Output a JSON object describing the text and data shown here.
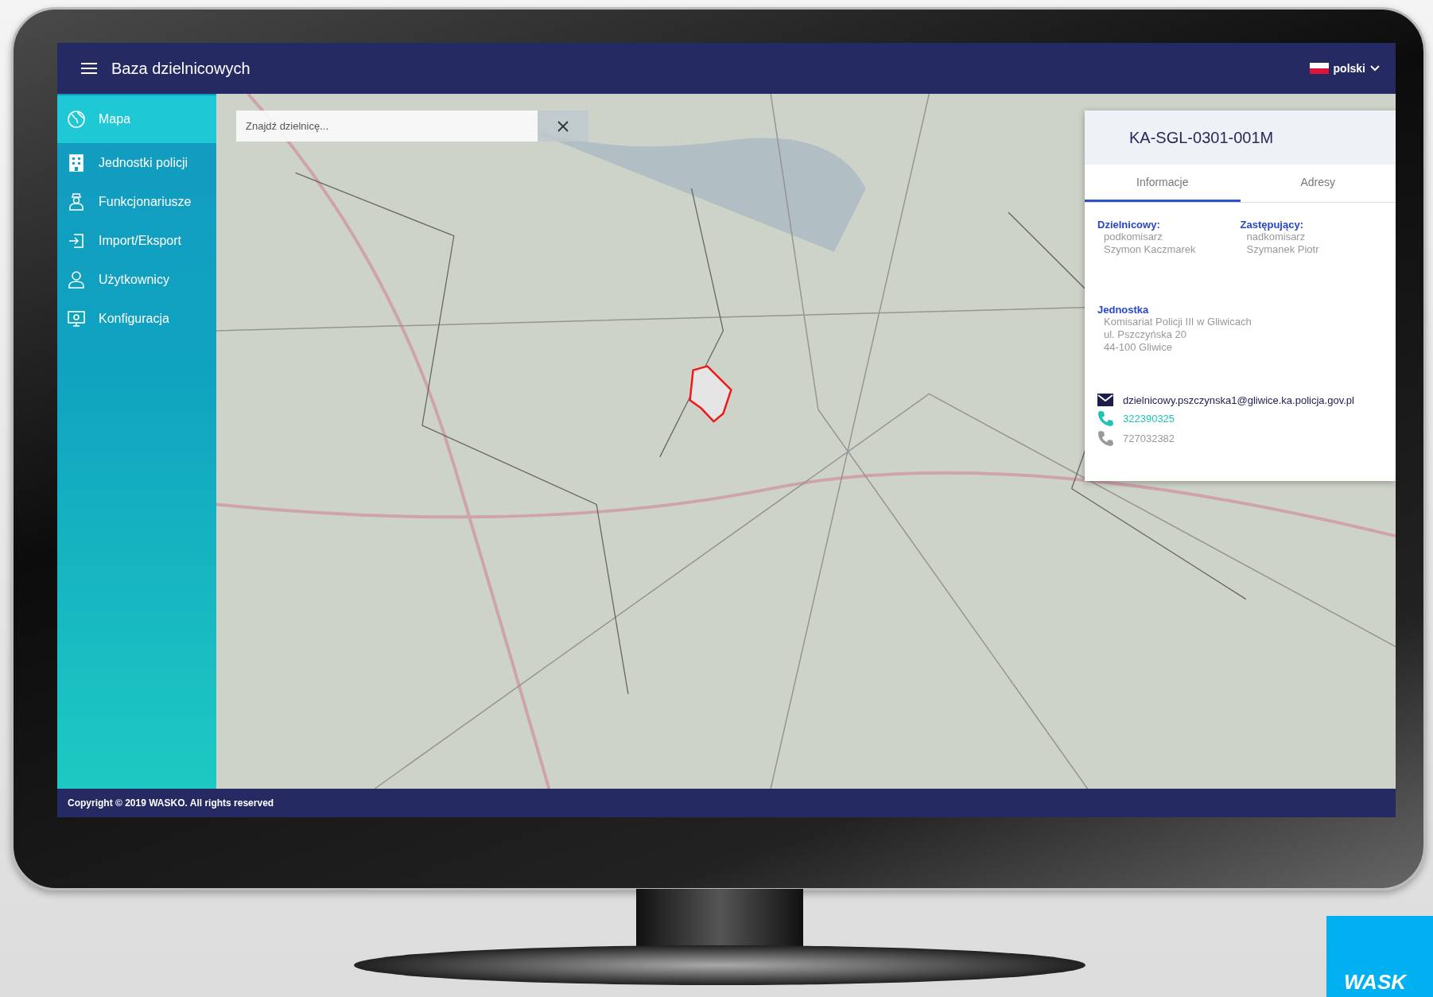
{
  "app": {
    "title": "Baza dzielnicowych",
    "language": {
      "label": "polski"
    }
  },
  "sidebar": {
    "items": [
      {
        "label": "Mapa",
        "selected": true
      },
      {
        "label": "Jednostki policji",
        "selected": false
      },
      {
        "label": "Funkcjonariusze",
        "selected": false
      },
      {
        "label": "Import/Eksport",
        "selected": false
      },
      {
        "label": "Użytkownicy",
        "selected": false
      },
      {
        "label": "Konfiguracja",
        "selected": false
      }
    ]
  },
  "search": {
    "placeholder": "Znajdź dzielnicę..."
  },
  "panel": {
    "title": "KA-SGL-0301-001M",
    "tabs": [
      {
        "label": "Informacje",
        "selected": true
      },
      {
        "label": "Adresy",
        "selected": false
      }
    ],
    "officers": [
      {
        "heading": "Dzielnicowy:",
        "rank": "podkomisarz",
        "name": "Szymon Kaczmarek"
      },
      {
        "heading": "Zastępujący:",
        "rank": "nadkomisarz",
        "name": "Szymanek Piotr"
      }
    ],
    "unit": {
      "heading": "Jednostka",
      "lines": [
        "Komisariat Policji III w Gliwicach",
        "ul. Pszczyńska 20",
        "44-100 Gliwice"
      ]
    },
    "contacts": [
      {
        "kind": "email",
        "value": "dzielnicowy.pszczynska1@gliwice.ka.policja.gov.pl",
        "primary": false
      },
      {
        "kind": "phone",
        "value": "322390325",
        "primary": true
      },
      {
        "kind": "phone",
        "value": "727032382",
        "primary": false
      }
    ]
  },
  "footer": {
    "copyright": "Copyright © 2019 WASKO. All rights reserved"
  },
  "corner_logo": {
    "text": "WASK"
  }
}
